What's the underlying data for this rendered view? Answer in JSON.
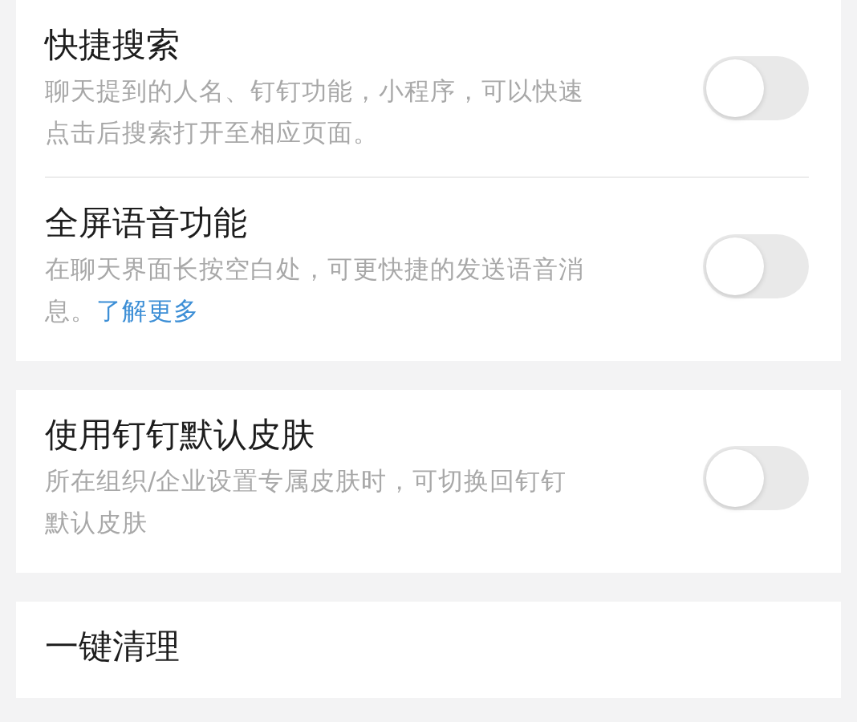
{
  "sections": [
    {
      "items": [
        {
          "kind": "switch",
          "title": "快捷搜索",
          "description": "聊天提到的人名、钉钉功能，小程序，可以快速点击后搜索打开至相应页面。",
          "on": false
        },
        {
          "kind": "switch",
          "title": "全屏语音功能",
          "description": "在聊天界面长按空白处，可更快捷的发送语音消息。",
          "link": "了解更多",
          "on": false
        }
      ]
    },
    {
      "items": [
        {
          "kind": "switch",
          "title": "使用钉钉默认皮肤",
          "description": "所在组织/企业设置专属皮肤时，可切换回钉钉默认皮肤",
          "on": false
        }
      ]
    },
    {
      "items": [
        {
          "kind": "action",
          "title": "一键清理"
        }
      ]
    }
  ]
}
